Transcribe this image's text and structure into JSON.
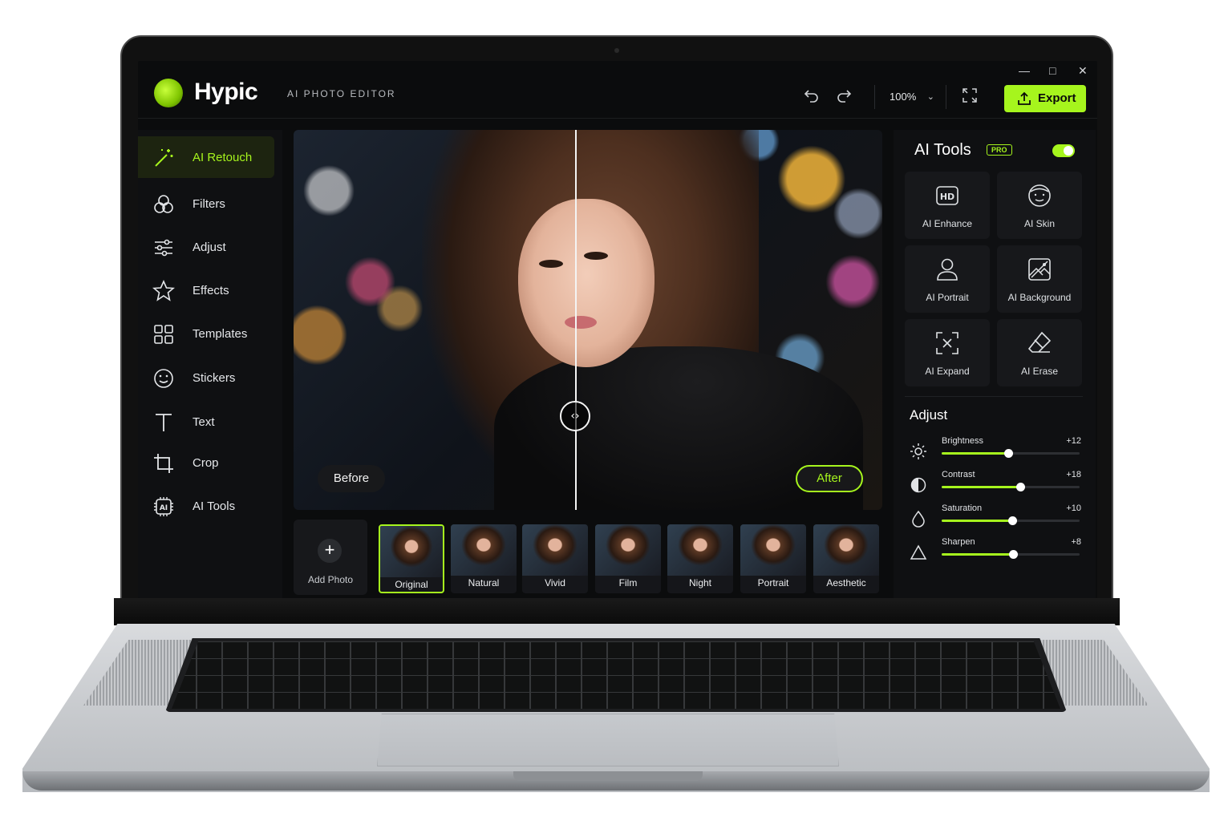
{
  "app": {
    "name": "Hypic",
    "subtitle": "AI PHOTO EDITOR"
  },
  "toolbar": {
    "zoom": "100%",
    "export_label": "Export",
    "accent": "#a6f51d"
  },
  "sidebar": {
    "items": [
      {
        "label": "AI Retouch",
        "icon": "magic-wand-icon",
        "active": true
      },
      {
        "label": "Filters",
        "icon": "filters-icon"
      },
      {
        "label": "Adjust",
        "icon": "sliders-icon"
      },
      {
        "label": "Effects",
        "icon": "star-icon"
      },
      {
        "label": "Templates",
        "icon": "grid-icon"
      },
      {
        "label": "Stickers",
        "icon": "smiley-icon"
      },
      {
        "label": "Text",
        "icon": "text-icon"
      },
      {
        "label": "Crop",
        "icon": "crop-icon"
      },
      {
        "label": "AI Tools",
        "icon": "ai-chip-icon"
      }
    ]
  },
  "canvas": {
    "before_label": "Before",
    "after_label": "After"
  },
  "filmstrip": {
    "add_label": "Add Photo",
    "thumbs": [
      "Original",
      "Natural",
      "Vivid",
      "Film",
      "Night",
      "Portrait",
      "Aesthetic"
    ]
  },
  "ai_tools": {
    "title": "AI Tools",
    "badge": "PRO",
    "enabled": true,
    "tools": [
      {
        "label": "AI Enhance",
        "icon": "hd-icon"
      },
      {
        "label": "AI Skin",
        "icon": "face-icon"
      },
      {
        "label": "AI Portrait",
        "icon": "person-icon"
      },
      {
        "label": "AI Background",
        "icon": "image-icon"
      },
      {
        "label": "AI Expand",
        "icon": "expand-icon"
      },
      {
        "label": "AI Erase",
        "icon": "eraser-icon"
      }
    ]
  },
  "adjust": {
    "title": "Adjust",
    "sliders": [
      {
        "name": "Brightness",
        "value": "+12",
        "level": 0.48,
        "icon": "sun-icon"
      },
      {
        "name": "Contrast",
        "value": "+18",
        "level": 0.57,
        "icon": "contrast-icon"
      },
      {
        "name": "Saturation",
        "value": "+10",
        "level": 0.51,
        "icon": "drop-icon"
      },
      {
        "name": "Sharpen",
        "value": "+8",
        "level": 0.52,
        "icon": "triangle-icon"
      }
    ]
  }
}
